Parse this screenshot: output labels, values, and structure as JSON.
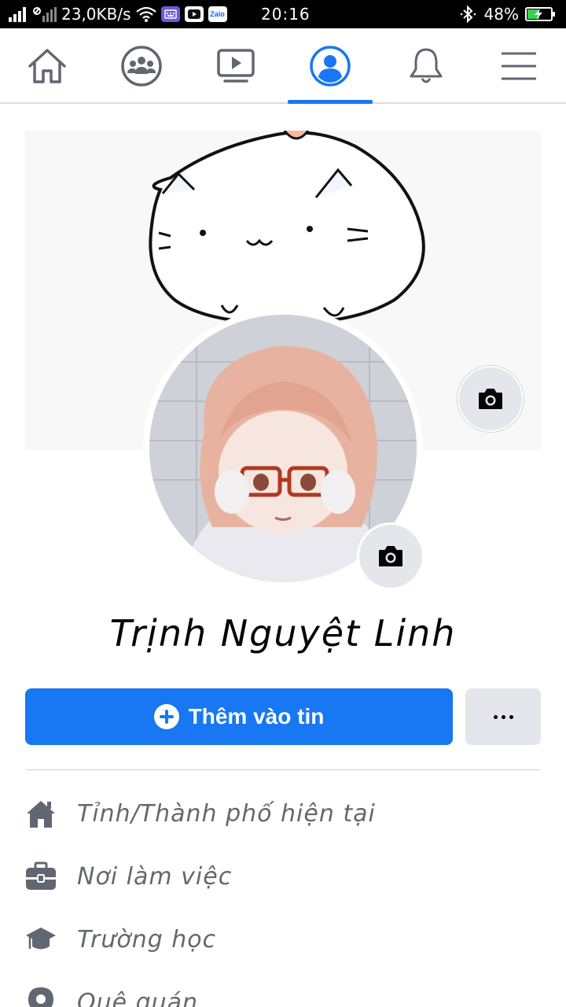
{
  "status_bar": {
    "net_speed": "23,0KB/s",
    "zalo_label": "Zalo",
    "time": "20:16",
    "battery": "48%"
  },
  "nav": {
    "tabs": [
      {
        "name": "home"
      },
      {
        "name": "groups"
      },
      {
        "name": "watch"
      },
      {
        "name": "profile",
        "active": true
      },
      {
        "name": "notifications"
      },
      {
        "name": "menu"
      }
    ],
    "accent_color": "#1877f2"
  },
  "profile": {
    "name": "Trịnh Nguyệt Linh",
    "add_story_label": "Thêm vào tin",
    "more_icon": "ellipsis-icon",
    "cover_camera_icon": "camera-icon",
    "avatar_camera_icon": "camera-icon"
  },
  "details": [
    {
      "icon": "house-icon",
      "label": "Tỉnh/Thành phố hiện tại"
    },
    {
      "icon": "briefcase-icon",
      "label": "Nơi làm việc"
    },
    {
      "icon": "graduation-cap-icon",
      "label": "Trường học"
    },
    {
      "icon": "location-pin-icon",
      "label": "Quê quán"
    }
  ]
}
